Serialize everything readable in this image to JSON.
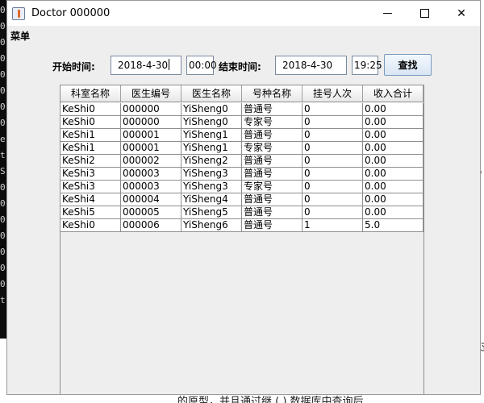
{
  "window": {
    "title": "Doctor 000000",
    "menu": "菜单"
  },
  "filters": {
    "start_label": "开始时间:",
    "start_date": "2018-4-30",
    "start_time": "00:00",
    "end_label": "结束时间:",
    "end_date": "2018-4-30",
    "end_time": "19:25",
    "search_label": "查找"
  },
  "table": {
    "columns": [
      "科室名称",
      "医生编号",
      "医生名称",
      "号种名称",
      "挂号人次",
      "收入合计"
    ],
    "rows": [
      [
        "KeShi0",
        "000000",
        "YiSheng0",
        "普通号",
        "0",
        "0.00"
      ],
      [
        "KeShi0",
        "000000",
        "YiSheng0",
        "专家号",
        "0",
        "0.00"
      ],
      [
        "KeShi1",
        "000001",
        "YiSheng1",
        "普通号",
        "0",
        "0.00"
      ],
      [
        "KeShi1",
        "000001",
        "YiSheng1",
        "专家号",
        "0",
        "0.00"
      ],
      [
        "KeShi2",
        "000002",
        "YiSheng2",
        "普通号",
        "0",
        "0.00"
      ],
      [
        "KeShi3",
        "000003",
        "YiSheng3",
        "普通号",
        "0",
        "0.00"
      ],
      [
        "KeShi3",
        "000003",
        "YiSheng3",
        "专家号",
        "0",
        "0.00"
      ],
      [
        "KeShi4",
        "000004",
        "YiSheng4",
        "普通号",
        "0",
        "0.00"
      ],
      [
        "KeShi5",
        "000005",
        "YiSheng5",
        "普通号",
        "0",
        "0.00"
      ],
      [
        "KeShi0",
        "000006",
        "YiSheng6",
        "普通号",
        "1",
        "5.0"
      ]
    ]
  },
  "background": {
    "left_glyphs": [
      "0",
      "0",
      "0",
      "0",
      "0",
      "0",
      "0",
      "0",
      "e",
      "t",
      "S",
      "0",
      "0",
      "0",
      "0",
      "0",
      "0",
      "0",
      "t"
    ],
    "right_glyphs": [
      "。",
      "过"
    ],
    "bottom_text": "的原型，并且通过继  (  )  数据库中查询后"
  }
}
